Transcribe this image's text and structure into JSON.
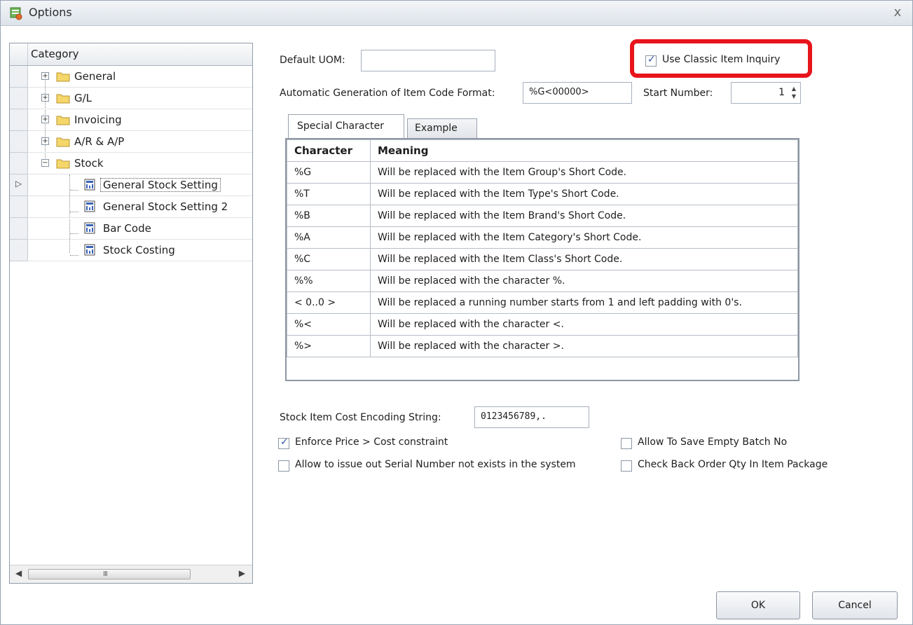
{
  "window": {
    "title": "Options",
    "close_glyph": "x"
  },
  "tree": {
    "header": "Category",
    "nodes": [
      {
        "label": "General",
        "expander": "+"
      },
      {
        "label": "G/L",
        "expander": "+"
      },
      {
        "label": "Invoicing",
        "expander": "+"
      },
      {
        "label": "A/R & A/P",
        "expander": "+"
      },
      {
        "label": "Stock",
        "expander": "−"
      }
    ],
    "stock_children": [
      {
        "label": "General Stock Setting",
        "selected": true
      },
      {
        "label": "General Stock Setting 2"
      },
      {
        "label": "Bar Code"
      },
      {
        "label": "Stock Costing"
      }
    ],
    "scroll_grip": "III"
  },
  "form": {
    "default_uom_label": "Default UOM:",
    "default_uom_value": "",
    "use_classic_label": "Use Classic Item Inquiry",
    "use_classic_checked": true,
    "auto_gen_label": "Automatic Generation of Item Code Format:",
    "auto_gen_value": "%G<00000>",
    "start_number_label": "Start Number:",
    "start_number_value": "1",
    "tabs": [
      "Special Character",
      "Example"
    ],
    "grid_headers": [
      "Character",
      "Meaning"
    ],
    "grid_rows": [
      [
        "%G",
        "Will be replaced with the Item Group's Short Code."
      ],
      [
        "%T",
        "Will be replaced with the Item Type's Short Code."
      ],
      [
        "%B",
        "Will be replaced with the Item Brand's Short Code."
      ],
      [
        "%A",
        "Will be replaced with the Item Category's Short Code."
      ],
      [
        "%C",
        "Will be replaced with the Item Class's Short Code."
      ],
      [
        "%%",
        "Will be replaced with the character %."
      ],
      [
        "< 0..0 >",
        "Will be replaced a running number starts from 1 and left padding with 0's."
      ],
      [
        "%<",
        "Will be replaced with the character <."
      ],
      [
        "%>",
        "Will be replaced with the character >."
      ]
    ],
    "encoding_label": "Stock Item Cost Encoding String:",
    "encoding_value": "0123456789,.",
    "enforce_price_label": "Enforce Price > Cost constraint",
    "enforce_price_checked": true,
    "allow_serial_label": "Allow to issue out Serial Number not exists in the system",
    "allow_serial_checked": false,
    "allow_empty_batch_label": "Allow To Save Empty Batch No",
    "allow_empty_batch_checked": false,
    "check_back_order_label": "Check Back Order Qty In Item Package",
    "check_back_order_checked": false
  },
  "buttons": {
    "ok": "OK",
    "cancel": "Cancel"
  },
  "colors": {
    "highlight": "#e8141b",
    "checkmark": "#2d55a3",
    "folder": "#f5d66b"
  }
}
